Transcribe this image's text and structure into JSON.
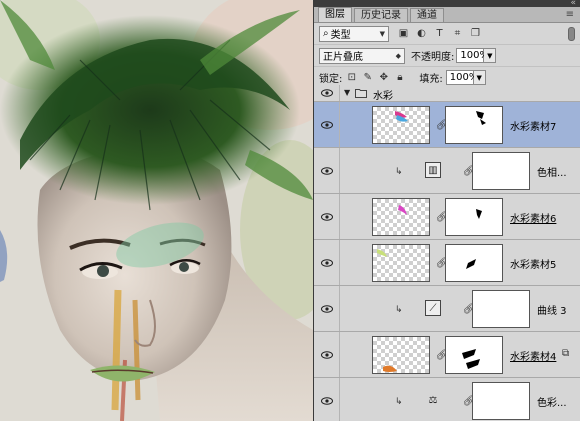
{
  "panel": {
    "tabs": [
      {
        "label": "图层",
        "active": true
      },
      {
        "label": "历史记录",
        "active": false
      },
      {
        "label": "通道",
        "active": false
      }
    ],
    "filter": {
      "kind_label": "类型",
      "search_icon": "search-icon"
    },
    "blend": {
      "mode": "正片叠底",
      "opacity_label": "不透明度:",
      "opacity_value": "100%"
    },
    "lock": {
      "label": "锁定:",
      "fill_label": "填充:",
      "fill_value": "100%"
    },
    "group": {
      "name": "水彩"
    },
    "layers": [
      {
        "name": "水彩素材7",
        "kind": "watercolor",
        "selected": true
      },
      {
        "name": "色相...",
        "kind": "adjustment-hue"
      },
      {
        "name": "水彩素材6",
        "kind": "watercolor",
        "underline": true
      },
      {
        "name": "水彩素材5",
        "kind": "watercolor"
      },
      {
        "name": "曲线 3",
        "kind": "adjustment-curves"
      },
      {
        "name": "水彩素材4",
        "kind": "watercolor",
        "underline": true,
        "smart_object": true
      },
      {
        "name": "色彩...",
        "kind": "adjustment-balance"
      }
    ]
  },
  "colors": {
    "panel_bg": "#d6d6d6",
    "selected_row": "#9fb3d8",
    "canvas_bg": "#dcdad3"
  }
}
